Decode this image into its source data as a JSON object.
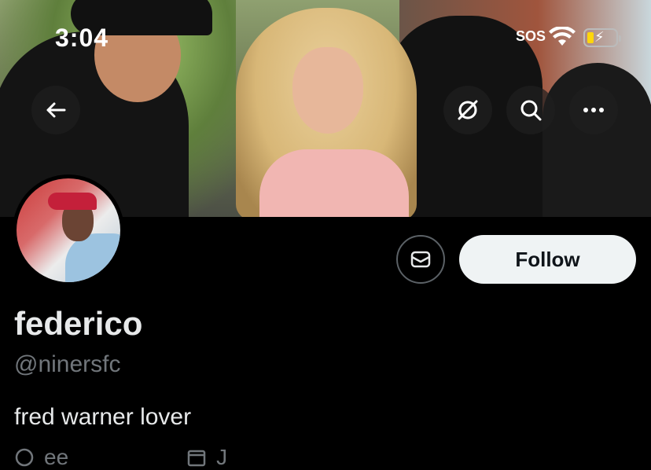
{
  "status_bar": {
    "time": "3:04",
    "sos": "SOS",
    "battery_color": "#ffd60a"
  },
  "header_buttons": {
    "back_icon": "arrow-left-icon",
    "grok_icon": "grok-icon",
    "search_icon": "search-icon",
    "more_icon": "more-icon"
  },
  "profile": {
    "display_name": "federico",
    "handle": "@ninersfc",
    "bio": "fred warner lover",
    "follow_label": "Follow",
    "message_icon": "mail-icon",
    "meta": {
      "link_text": "ee",
      "joined_text": "J",
      "link_icon": "link-icon",
      "calendar_icon": "calendar-icon"
    }
  },
  "colors": {
    "background": "#000000",
    "primary_text": "#e7e9ea",
    "secondary_text": "#71767b",
    "follow_bg": "#eff3f4",
    "follow_text": "#0f1419"
  }
}
